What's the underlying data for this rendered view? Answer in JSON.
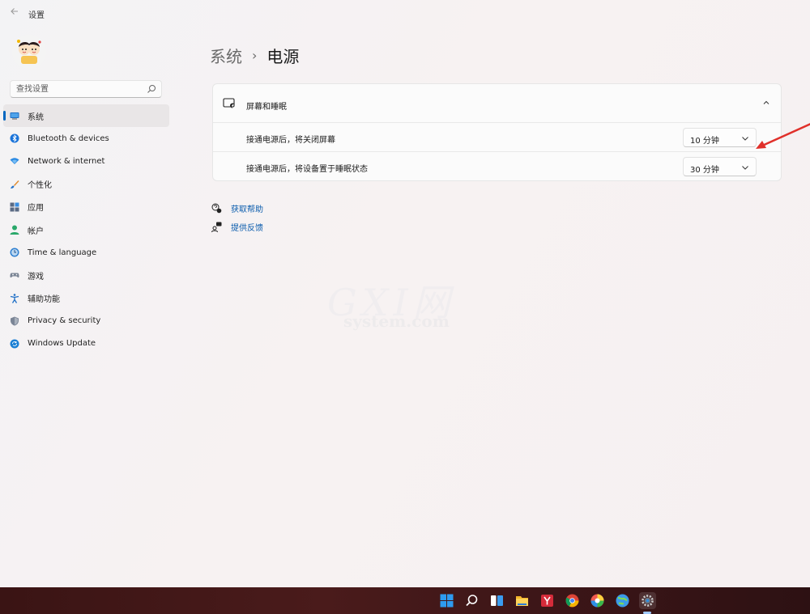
{
  "window": {
    "title": "设置"
  },
  "search": {
    "placeholder": "查找设置"
  },
  "sidebar": {
    "items": [
      {
        "label": "系统",
        "icon": "system-icon",
        "active": true
      },
      {
        "label": "Bluetooth & devices",
        "icon": "bluetooth-icon"
      },
      {
        "label": "Network & internet",
        "icon": "network-icon"
      },
      {
        "label": "个性化",
        "icon": "personalization-brush-icon"
      },
      {
        "label": "应用",
        "icon": "apps-icon"
      },
      {
        "label": "帐户",
        "icon": "accounts-icon"
      },
      {
        "label": "Time & language",
        "icon": "time-language-icon"
      },
      {
        "label": "游戏",
        "icon": "gaming-icon"
      },
      {
        "label": "辅助功能",
        "icon": "accessibility-icon"
      },
      {
        "label": "Privacy & security",
        "icon": "shield-icon"
      },
      {
        "label": "Windows Update",
        "icon": "windows-update-icon"
      }
    ]
  },
  "breadcrumb": {
    "parent": "系统",
    "separator": "›",
    "current": "电源"
  },
  "card": {
    "title": "屏幕和睡眠",
    "rows": [
      {
        "label": "接通电源后，将关闭屏幕",
        "value": "10 分钟"
      },
      {
        "label": "接通电源后，将设备置于睡眠状态",
        "value": "30 分钟"
      }
    ]
  },
  "links": {
    "help": "获取帮助",
    "feedback": "提供反馈"
  },
  "watermark": {
    "main": "GXI网",
    "sub": "system.com"
  },
  "taskbar": {
    "icons": [
      "windows-start-icon",
      "search-icon",
      "task-view-icon",
      "file-explorer-icon",
      "app-y-icon",
      "chrome-icon",
      "color-wheel-app-icon",
      "globe-app-icon",
      "settings-gear-icon"
    ]
  },
  "colors": {
    "accent": "#0067c0",
    "link": "#0b5cad",
    "annotation_arrow": "#e0302a",
    "taskbar": "#3a1414"
  }
}
